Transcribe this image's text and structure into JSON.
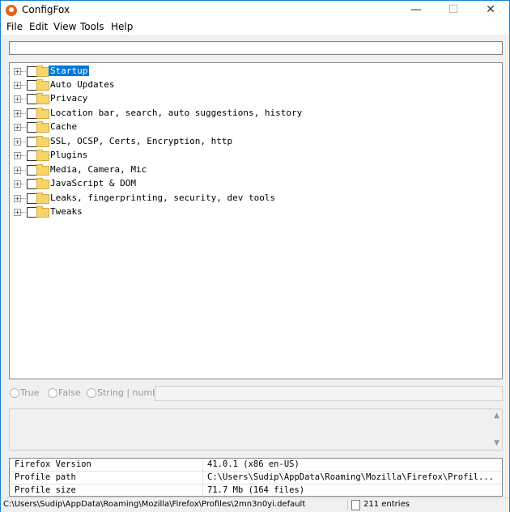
{
  "window": {
    "title": "ConfigFox",
    "minimize": "—",
    "maximize": "☐",
    "close": "✕"
  },
  "menu": [
    "File",
    "Edit",
    "View",
    "Tools",
    "Help"
  ],
  "search": {
    "value": "",
    "placeholder": ""
  },
  "tree": {
    "items": [
      {
        "label": "Startup",
        "selected": true
      },
      {
        "label": "Auto Updates"
      },
      {
        "label": "Privacy"
      },
      {
        "label": "Location bar, search, auto suggestions, history"
      },
      {
        "label": "Cache"
      },
      {
        "label": "SSL, OCSP, Certs, Encryption, http"
      },
      {
        "label": "Plugins"
      },
      {
        "label": "Media, Camera, Mic"
      },
      {
        "label": "JavaScript & DOM"
      },
      {
        "label": "Leaks, fingerprinting, security, dev tools"
      },
      {
        "label": "Tweaks"
      }
    ]
  },
  "value_editor": {
    "true_label": "True",
    "false_label": "False",
    "string_label": "String | number:",
    "value": ""
  },
  "description": {
    "text": "",
    "scroll_up": "▲",
    "scroll_down": "▼"
  },
  "info": [
    {
      "key": "Firefox Version",
      "value": "41.0.1 (x86 en-US)"
    },
    {
      "key": "Profile path",
      "value": "C:\\Users\\Sudip\\AppData\\Roaming\\Mozilla\\Firefox\\Profil..."
    },
    {
      "key": "Profile size",
      "value": "71.7 Mb (164 files)"
    }
  ],
  "status": {
    "path": "C:\\Users\\Sudip\\AppData\\Roaming\\Mozilla\\Firefox\\Profiles\\2mn3n0yi.default",
    "entries": "211 entries"
  }
}
